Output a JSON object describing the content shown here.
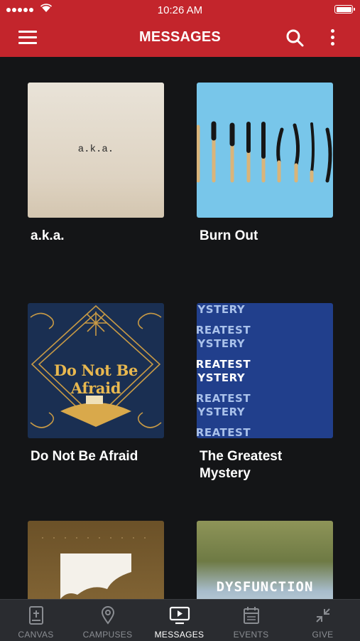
{
  "status_bar": {
    "time": "10:26 AM"
  },
  "header": {
    "title": "MESSAGES"
  },
  "messages": [
    {
      "title": "a.k.a.",
      "thumb_text": "a.k.a."
    },
    {
      "title": "Burn Out"
    },
    {
      "title": "Do Not Be Afraid",
      "thumb_text": "Do Not Be Afraid"
    },
    {
      "title": "The Greatest Mystery",
      "thumb_text": [
        "MYSTERY",
        "GREATEST",
        "MYSTERY",
        "GREATEST",
        "MYSTERY",
        "GREATEST",
        "MYSTERY",
        "GREATEST"
      ]
    },
    {
      "title": ""
    },
    {
      "title": "",
      "thumb_text": "DYSFUNCTION"
    }
  ],
  "tab_bar": {
    "tabs": [
      {
        "label": "CANVAS",
        "icon": "bible-icon"
      },
      {
        "label": "CAMPUSES",
        "icon": "location-pin-icon"
      },
      {
        "label": "MESSAGES",
        "icon": "tv-play-icon",
        "active": true
      },
      {
        "label": "EVENTS",
        "icon": "calendar-icon"
      },
      {
        "label": "GIVE",
        "icon": "give-arrows-icon"
      }
    ]
  },
  "colors": {
    "header": "#c3252c",
    "background": "#141517",
    "tab_bar": "#2a2c30"
  }
}
